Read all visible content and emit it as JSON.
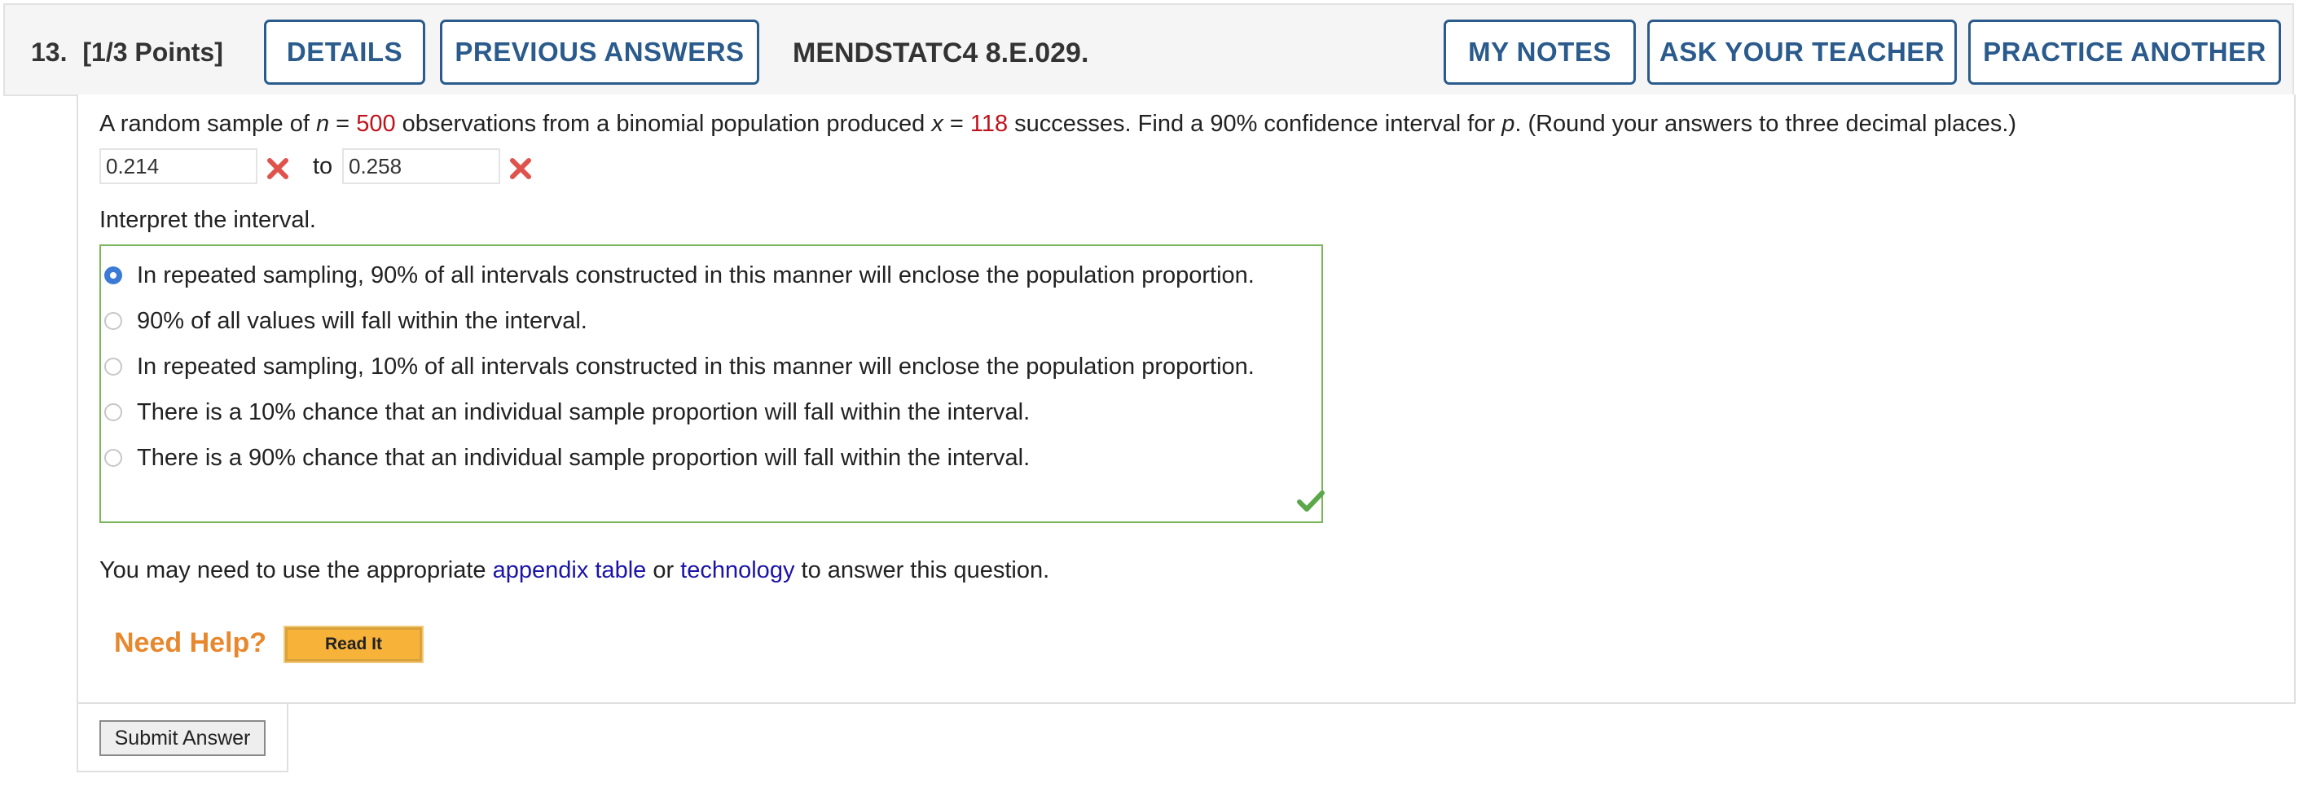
{
  "header": {
    "question_number": "13.",
    "points": "[1/3 Points]",
    "details_label": "DETAILS",
    "previous_answers_label": "PREVIOUS ANSWERS",
    "question_code": "MENDSTATC4 8.E.029.",
    "my_notes_label": "MY NOTES",
    "ask_teacher_label": "ASK YOUR TEACHER",
    "practice_another_label": "PRACTICE ANOTHER"
  },
  "question": {
    "part1": "A random sample of ",
    "n_var": "n",
    "eq1": " = ",
    "n_value": "500",
    "part2": " observations from a binomial population produced ",
    "x_var": "x",
    "eq2": " = ",
    "x_value": "118",
    "part3": " successes. Find a 90% confidence interval for ",
    "p_var": "p",
    "part4": ". (Round your answers to three decimal places.)"
  },
  "answers": {
    "lower_value": "0.214",
    "to_label": "to",
    "upper_value": "0.258",
    "lower_status": "incorrect",
    "upper_status": "incorrect"
  },
  "interpret": {
    "prompt": "Interpret the interval.",
    "selected_index": 0,
    "status": "correct",
    "options": [
      "In repeated sampling, 90% of all intervals constructed in this manner will enclose the population proportion.",
      "90% of all values will fall within the interval.",
      "In repeated sampling, 10% of all intervals constructed in this manner will enclose the population proportion.",
      "There is a 10% chance that an individual sample proportion will fall within the interval.",
      "There is a 90% chance that an individual sample proportion will fall within the interval."
    ]
  },
  "resources": {
    "prefix": "You may need to use the appropriate ",
    "appendix_link": "appendix table",
    "middle": " or ",
    "technology_link": "technology",
    "suffix": " to answer this question."
  },
  "help": {
    "need_help": "Need Help?",
    "read_it": "Read It"
  },
  "submit_label": "Submit Answer",
  "colors": {
    "brand_blue": "#2a5b8c",
    "highlight_red": "#c0121b",
    "correct_green": "#7ab55c",
    "help_orange": "#e8882e"
  },
  "icons": {
    "incorrect": "x-mark-icon",
    "correct": "check-mark-icon"
  }
}
